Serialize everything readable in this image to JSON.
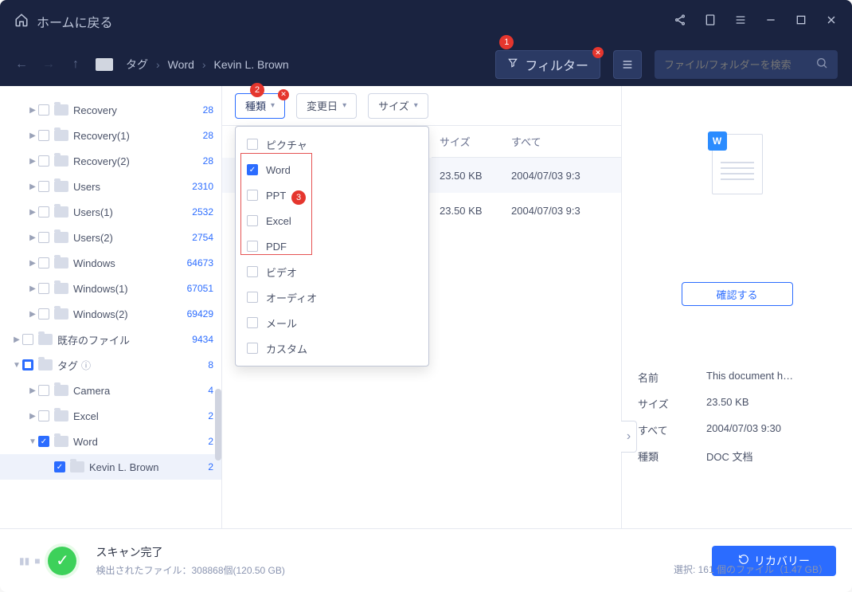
{
  "titlebar": {
    "home_label": "ホームに戻る"
  },
  "toolbar": {
    "breadcrumb": [
      "タグ",
      "Word",
      "Kevin L. Brown"
    ],
    "filter_label": "フィルター",
    "search_placeholder": "ファイル/フォルダーを検索"
  },
  "filter_chips": {
    "type": "種類",
    "date": "変更日",
    "size": "サイズ"
  },
  "type_dropdown": {
    "items": [
      {
        "label": "ピクチャ",
        "checked": false
      },
      {
        "label": "Word",
        "checked": true
      },
      {
        "label": "PPT",
        "checked": false
      },
      {
        "label": "Excel",
        "checked": false
      },
      {
        "label": "PDF",
        "checked": false
      },
      {
        "label": "ビデオ",
        "checked": false
      },
      {
        "label": "オーディオ",
        "checked": false
      },
      {
        "label": "メール",
        "checked": false
      },
      {
        "label": "カスタム",
        "checked": false
      }
    ]
  },
  "sidebar": {
    "items": [
      {
        "label": "Recovery",
        "count": "28",
        "indent": 1,
        "arrow": "▶",
        "cb": "",
        "selected": false
      },
      {
        "label": "Recovery(1)",
        "count": "28",
        "indent": 1,
        "arrow": "▶",
        "cb": "",
        "selected": false
      },
      {
        "label": "Recovery(2)",
        "count": "28",
        "indent": 1,
        "arrow": "▶",
        "cb": "",
        "selected": false
      },
      {
        "label": "Users",
        "count": "2310",
        "indent": 1,
        "arrow": "▶",
        "cb": "",
        "selected": false
      },
      {
        "label": "Users(1)",
        "count": "2532",
        "indent": 1,
        "arrow": "▶",
        "cb": "",
        "selected": false
      },
      {
        "label": "Users(2)",
        "count": "2754",
        "indent": 1,
        "arrow": "▶",
        "cb": "",
        "selected": false
      },
      {
        "label": "Windows",
        "count": "64673",
        "indent": 1,
        "arrow": "▶",
        "cb": "",
        "selected": false
      },
      {
        "label": "Windows(1)",
        "count": "67051",
        "indent": 1,
        "arrow": "▶",
        "cb": "",
        "selected": false
      },
      {
        "label": "Windows(2)",
        "count": "69429",
        "indent": 1,
        "arrow": "▶",
        "cb": "",
        "selected": false
      },
      {
        "label": "既存のファイル",
        "count": "9434",
        "indent": 0,
        "arrow": "▶",
        "cb": "",
        "selected": false
      },
      {
        "label": "タグ",
        "count": "8",
        "indent": 0,
        "arrow": "▼",
        "cb": "partial",
        "selected": false,
        "help": true
      },
      {
        "label": "Camera",
        "count": "4",
        "indent": 1,
        "arrow": "▶",
        "cb": "",
        "selected": false
      },
      {
        "label": "Excel",
        "count": "2",
        "indent": 1,
        "arrow": "▶",
        "cb": "",
        "selected": false
      },
      {
        "label": "Word",
        "count": "2",
        "indent": 1,
        "arrow": "▼",
        "cb": "checked",
        "selected": false
      },
      {
        "label": "Kevin L. Brown",
        "count": "2",
        "indent": 2,
        "arrow": "",
        "cb": "checked",
        "selected": true
      }
    ]
  },
  "columns": {
    "size": "サイズ",
    "date": "すべて"
  },
  "rows": [
    {
      "size": "23.50 KB",
      "date": "2004/07/03 9:3"
    },
    {
      "size": "23.50 KB",
      "date": "2004/07/03 9:3"
    }
  ],
  "detail": {
    "confirm_label": "確認する",
    "fields": [
      {
        "k": "名前",
        "v": "This document h…"
      },
      {
        "k": "サイズ",
        "v": "23.50 KB"
      },
      {
        "k": "すべて",
        "v": "2004/07/03 9:30"
      },
      {
        "k": "種類",
        "v": "DOC 文档"
      }
    ]
  },
  "footer": {
    "status_title": "スキャン完了",
    "status_detail": "検出されたファイル：308868個(120.50 GB)",
    "recover_label": "リカバリー",
    "selection_info": "選択: 161 個のファイル（1.47 GB）"
  },
  "callouts": {
    "c1": "1",
    "c2": "2",
    "c3": "3"
  }
}
